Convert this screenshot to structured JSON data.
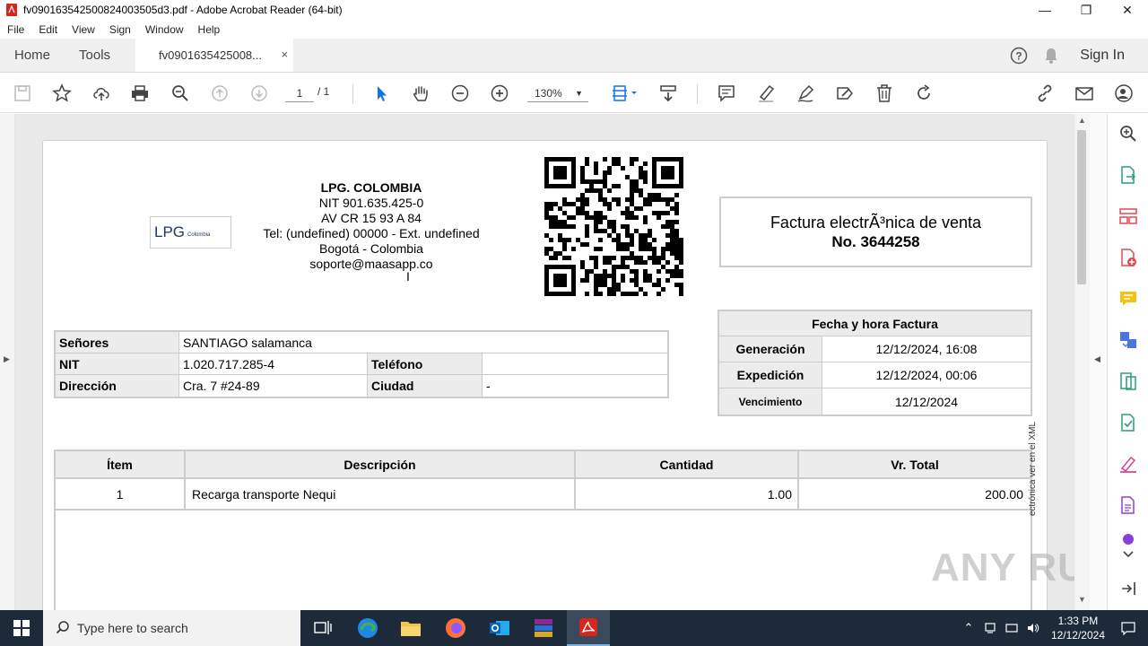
{
  "window": {
    "title": "fv09016354250082400350​5d3.pdf - Adobe Acrobat Reader (64-bit)",
    "minimize": "—",
    "maximize": "❐",
    "close": "✕"
  },
  "menu": [
    "File",
    "Edit",
    "View",
    "Sign",
    "Window",
    "Help"
  ],
  "tabs": {
    "home": "Home",
    "tools": "Tools",
    "document": "fv0901635425008...",
    "close": "×",
    "sign_in": "Sign In"
  },
  "toolbar": {
    "page_current": "1",
    "page_total": "/ 1",
    "zoom": "130%"
  },
  "invoice": {
    "logo_text": "LPG",
    "logo_sub": "Colombia",
    "company": {
      "name": "LPG. COLOMBIA",
      "nit": "NIT 901.635.425-0",
      "address": "AV CR 15 93 A 84",
      "phone": "Tel: (undefined) 00000 - Ext. undefined",
      "city": "Bogotá - Colombia",
      "email": "soporte@maasapp.co"
    },
    "title": "Factura electrÃ³nica de venta",
    "number": "No. 3644258",
    "dates": {
      "header": "Fecha y hora Factura",
      "generation_label": "Generación",
      "generation_value": "12/12/2024, 16:08",
      "issue_label": "Expedición",
      "issue_value": "12/12/2024, 00:06",
      "due_label": "Vencimiento",
      "due_value": "12/12/2024"
    },
    "client": {
      "name_label": "Señores",
      "name_value": "SANTIAGO salamanca",
      "nit_label": "NIT",
      "nit_value": "1.020.717.285-4",
      "phone_label": "Teléfono",
      "phone_value": "",
      "address_label": "Dirección",
      "address_value": "Cra. 7 #24-89",
      "city_label": "Ciudad",
      "city_value": "-"
    },
    "items_header": [
      "Ítem",
      "Descripción",
      "Cantidad",
      "Vr. Total"
    ],
    "items": [
      {
        "item": "1",
        "description": "Recarga transporte Nequi",
        "quantity": "1.00",
        "total": "200.00"
      }
    ],
    "side_text": "ectrónica ver en el XML"
  },
  "watermark": "ANY RUN",
  "taskbar": {
    "search_placeholder": "Type here to search",
    "time": "1:33 PM",
    "date": "12/12/2024"
  }
}
